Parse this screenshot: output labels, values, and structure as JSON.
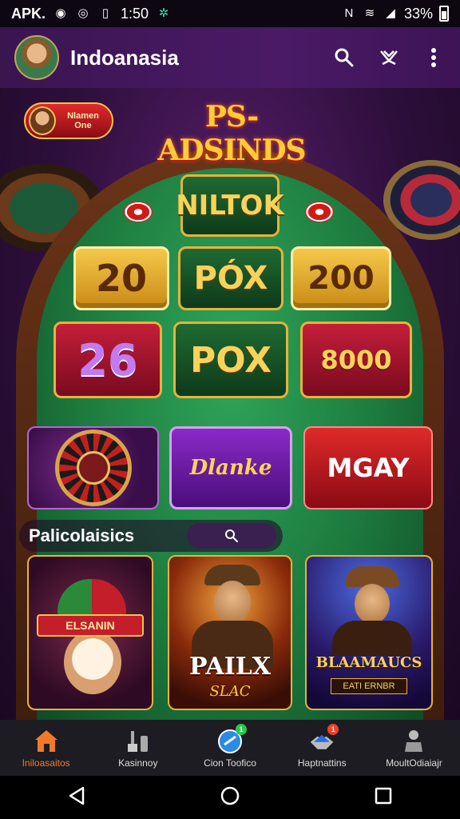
{
  "status_bar": {
    "left_text": "APK.",
    "time": "1:50",
    "battery": "33%",
    "icons": [
      "circle-icon",
      "at-icon",
      "phone-icon",
      "leaf-icon",
      "nfc-icon",
      "wifi-icon",
      "signal-icon",
      "battery-icon"
    ]
  },
  "app_bar": {
    "title": "Indoanasia",
    "actions": [
      "search-icon",
      "heart-hand-icon",
      "more-vert-icon"
    ]
  },
  "hero": {
    "badge_line1": "Nlamen",
    "badge_line2": "One",
    "headline": "PS-ADSINDS"
  },
  "tiles": {
    "top": "NILTOK",
    "row1": [
      "20",
      "PÓX",
      "200"
    ],
    "row2": [
      "26",
      "POX",
      "8000"
    ]
  },
  "promos": {
    "middle": "Dlanke",
    "right": "MGAY"
  },
  "section": {
    "title": "Palicolaisics"
  },
  "cards": [
    {
      "banner": "ELSANIN"
    },
    {
      "banner": "PAILX",
      "sub": "SLAC"
    },
    {
      "banner": "BLAAMAUCS",
      "sub": "EATI ERNBR"
    }
  ],
  "bottom_nav": [
    {
      "label": "Iniloasaitos",
      "icon": "home-icon",
      "active": true
    },
    {
      "label": "Kasinnoy",
      "icon": "tools-icon",
      "active": false
    },
    {
      "label": "Cion Toofico",
      "icon": "globe-icon",
      "active": false,
      "badge": "1"
    },
    {
      "label": "Haptnattins",
      "icon": "handshake-icon",
      "active": false,
      "badge": "1"
    },
    {
      "label": "MoultOdiaiajr",
      "icon": "person-icon",
      "active": false
    }
  ],
  "colors": {
    "accent": "#f07a2a",
    "app_bar": "#4a1a66",
    "felt": "#1d7a3e",
    "gold": "#e8b23a"
  }
}
